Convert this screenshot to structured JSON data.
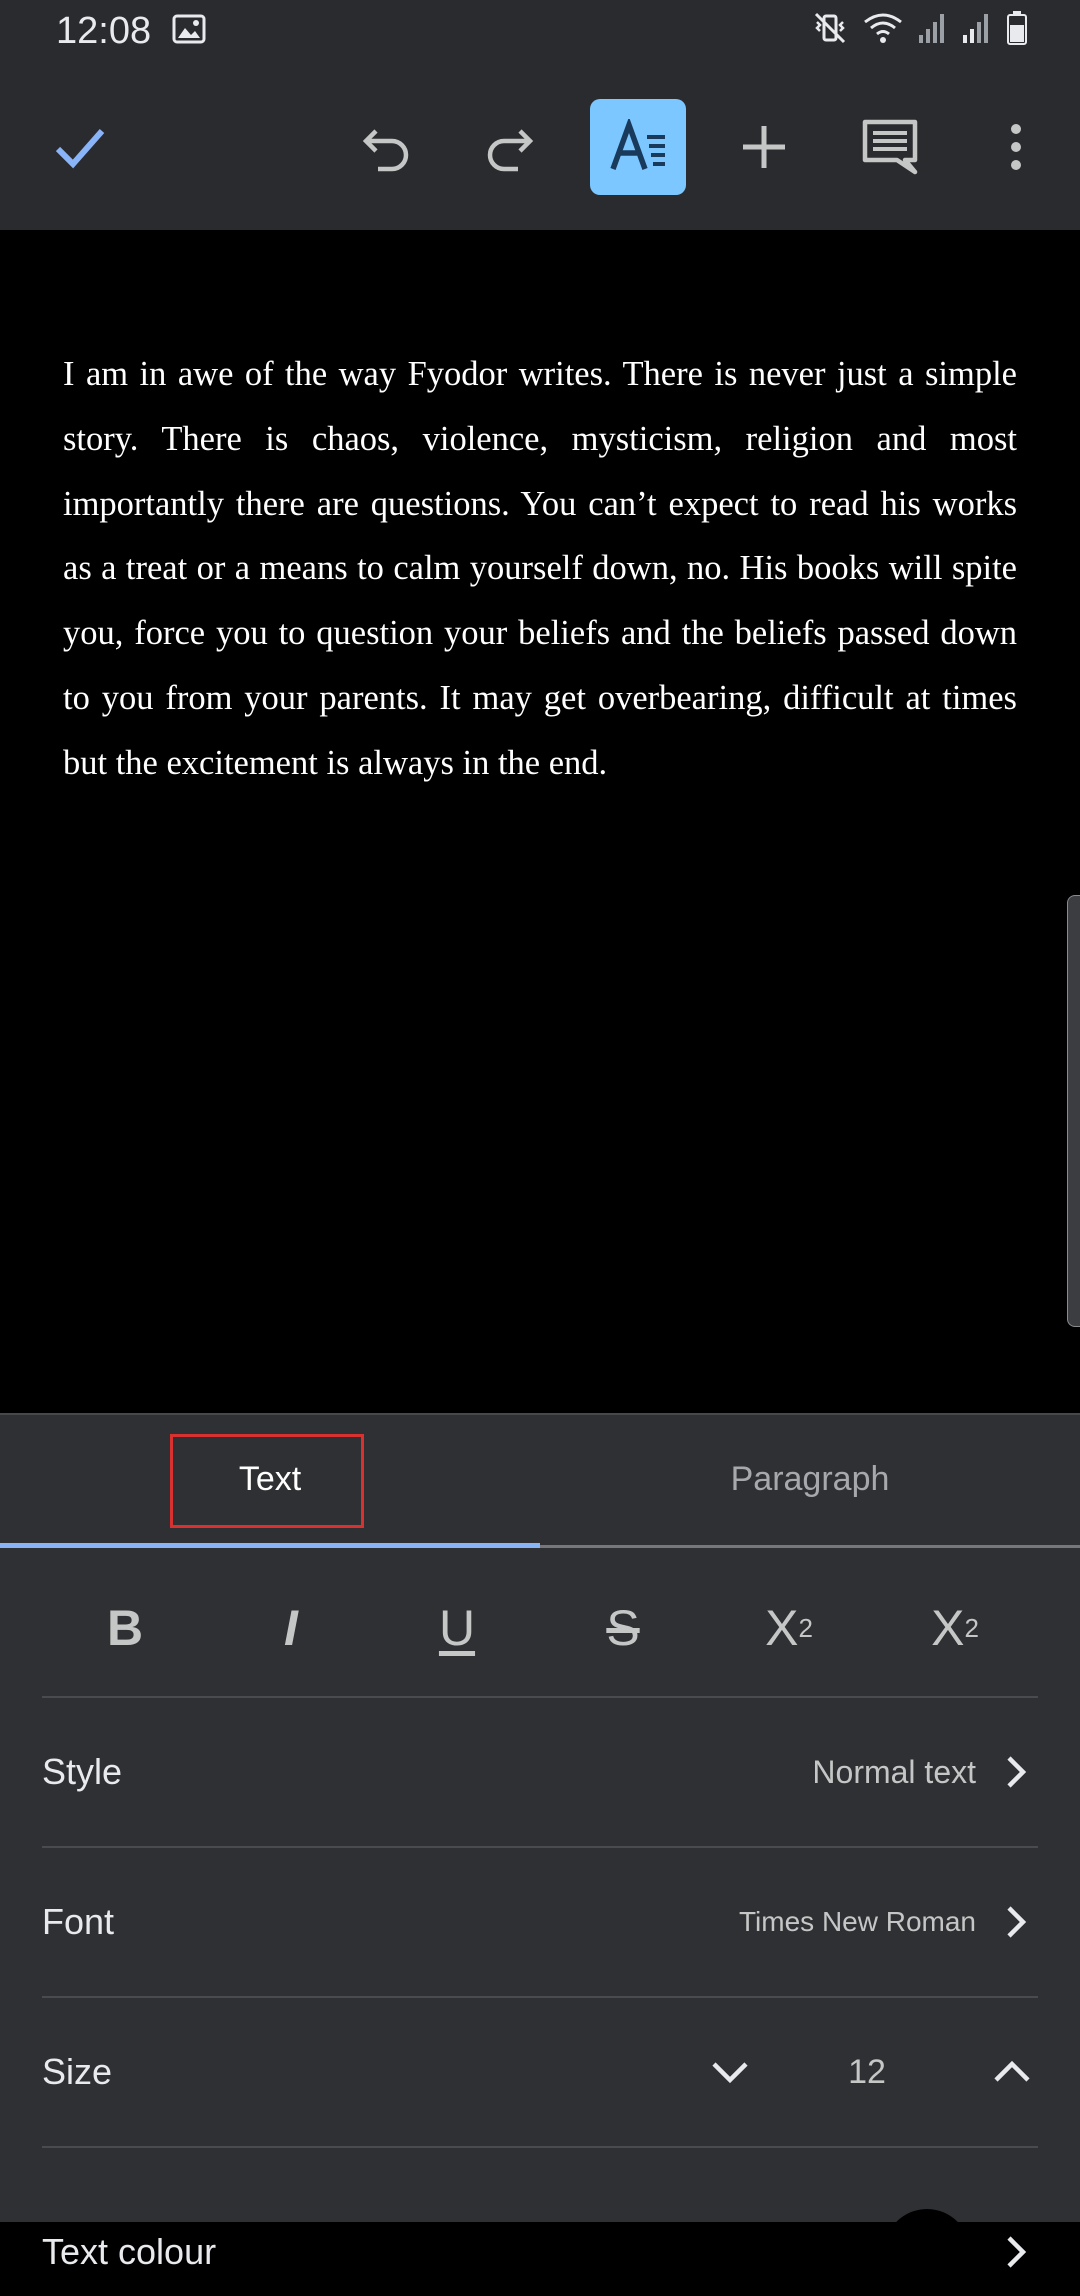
{
  "status_bar": {
    "time": "12:08"
  },
  "toolbar": {
    "icons": [
      "check-icon",
      "undo-icon",
      "redo-icon",
      "text-format-icon",
      "add-icon",
      "comment-icon",
      "more-vert-icon"
    ],
    "active_color": "#7cc7ff",
    "check_color": "#8ab4f8"
  },
  "document": {
    "body_text": "I am in awe of the way Fyodor writes. There is never just a simple story. There is chaos, violence, mysticism, religion and most importantly there are questions. You can’t expect to read his works as a treat or a means to calm yourself down, no. His books will spite you, force you to question your beliefs and the beliefs passed down to you from your parents. It may get overbearing, difficult at times but the excitement is always in the end."
  },
  "format_panel": {
    "tabs": [
      {
        "label": "Text",
        "selected": true
      },
      {
        "label": "Paragraph",
        "selected": false
      }
    ],
    "text_format_buttons": {
      "bold": "B",
      "italic": "I",
      "underline": "U",
      "strikethrough": "S",
      "superscript_base": "X",
      "superscript_mark": "2",
      "subscript_base": "X",
      "subscript_mark": "2"
    },
    "style": {
      "label": "Style",
      "value": "Normal text"
    },
    "font": {
      "label": "Font",
      "value": "Times New Roman"
    },
    "size": {
      "label": "Size",
      "value": "12"
    },
    "text_colour": {
      "label": "Text colour",
      "swatch_color": "#000000"
    }
  }
}
